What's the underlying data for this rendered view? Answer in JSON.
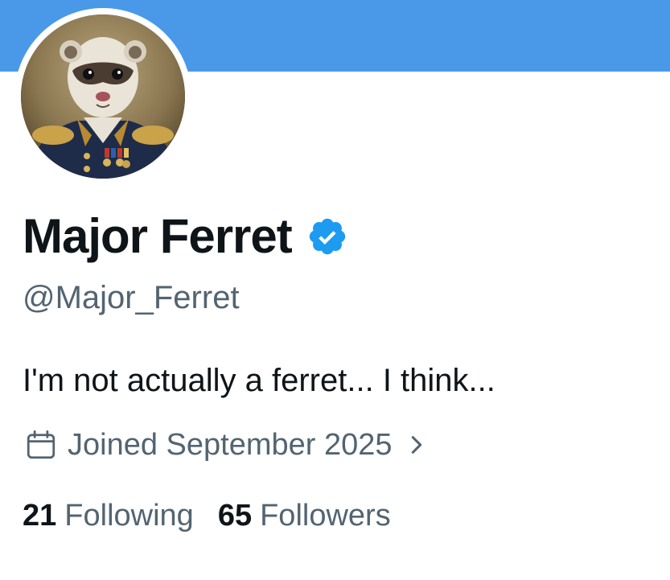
{
  "profile": {
    "display_name": "Major Ferret",
    "handle": "@Major_Ferret",
    "bio": "I'm not actually a ferret... I think...",
    "joined": "Joined September 2025",
    "following_count": "21",
    "following_label": "Following",
    "followers_count": "65",
    "followers_label": "Followers"
  },
  "icons": {
    "verified": "verified-badge-icon",
    "calendar": "calendar-icon",
    "chevron": "chevron-right-icon"
  },
  "colors": {
    "banner": "#4a99e9",
    "verified": "#1d9bf0",
    "text_primary": "#0f1419",
    "text_secondary": "#536471"
  }
}
